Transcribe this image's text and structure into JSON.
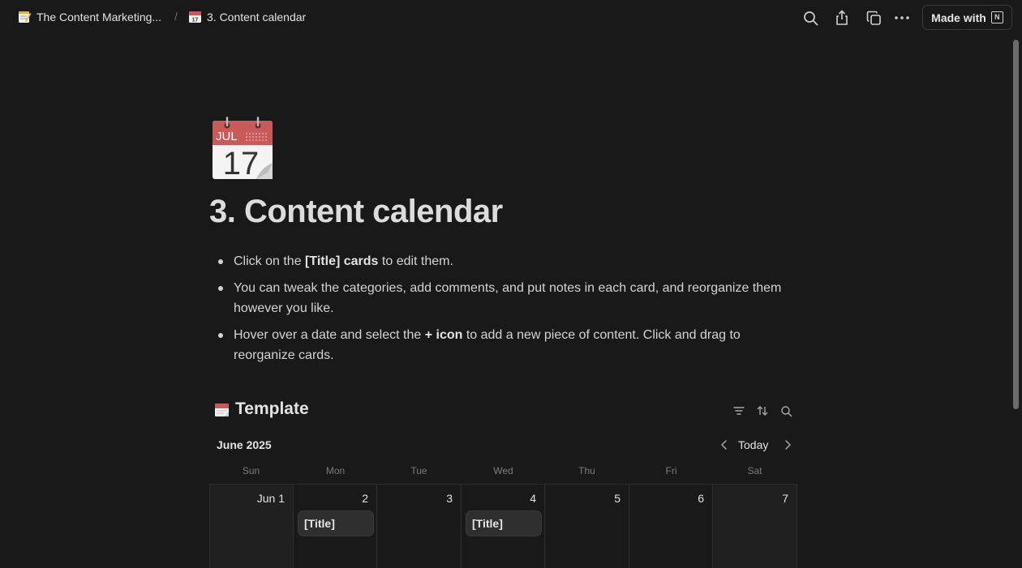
{
  "breadcrumb": {
    "parent": {
      "label": "The Content Marketing...",
      "icon": "memo-icon"
    },
    "separator": "/",
    "current": {
      "label": "3. Content calendar",
      "icon": "calendar-icon"
    }
  },
  "topbar": {
    "actions": [
      "search-icon",
      "share-icon",
      "duplicate-icon",
      "more-icon"
    ],
    "made_with_label": "Made with",
    "made_with_logo": "N"
  },
  "page": {
    "icon": {
      "name": "calendar-icon",
      "month": "JUL",
      "day": "17"
    },
    "title": "3. Content calendar",
    "bullets": [
      {
        "pre": "Click on the ",
        "bold": "[Title] cards",
        "post": " to edit them."
      },
      {
        "pre": "You can tweak the categories, add comments, and put notes in each card, and reorganize them however you like.",
        "bold": "",
        "post": ""
      },
      {
        "pre": "Hover over a date and select the ",
        "bold": "+ icon",
        "post": " to add a new piece of content. Click and drag to reorganize cards."
      }
    ]
  },
  "database": {
    "icon": "calendar-tearoff-icon",
    "title": "Template",
    "tools": [
      "filter-icon",
      "sort-icon",
      "search-icon"
    ],
    "month": "June 2025",
    "today_label": "Today",
    "weekdays": [
      "Sun",
      "Mon",
      "Tue",
      "Wed",
      "Thu",
      "Fri",
      "Sat"
    ],
    "days": [
      {
        "label": "Jun 1",
        "weekend": true,
        "cards": []
      },
      {
        "label": "2",
        "weekend": false,
        "cards": [
          "[Title]"
        ]
      },
      {
        "label": "3",
        "weekend": false,
        "cards": []
      },
      {
        "label": "4",
        "weekend": false,
        "cards": [
          "[Title]"
        ]
      },
      {
        "label": "5",
        "weekend": false,
        "cards": []
      },
      {
        "label": "6",
        "weekend": false,
        "cards": []
      },
      {
        "label": "7",
        "weekend": true,
        "cards": []
      }
    ]
  },
  "colors": {
    "background": "#191919",
    "text": "#d4d4d4",
    "card": "#2f2f2f",
    "calendar_red": "#c85a5a"
  }
}
